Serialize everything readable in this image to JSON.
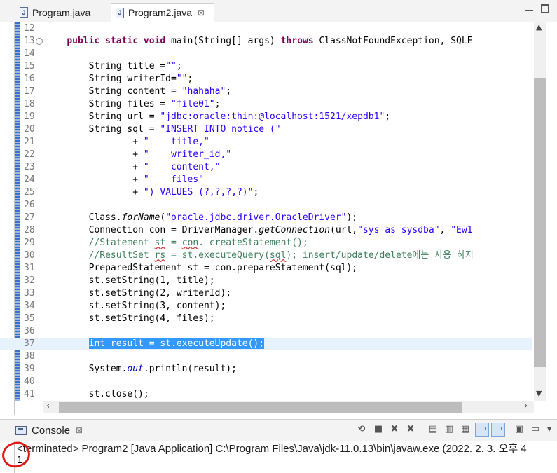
{
  "tabs": [
    {
      "label": "Program.java",
      "icon": "java-file-icon"
    },
    {
      "label": "Program2.java",
      "icon": "java-file-icon",
      "active": true,
      "close": "⊠"
    }
  ],
  "editor": {
    "lines": [
      {
        "n": "12",
        "segs": []
      },
      {
        "n": "13",
        "fold": "−",
        "segs": [
          {
            "t": "    "
          },
          {
            "t": "public",
            "c": "kw"
          },
          {
            "t": " "
          },
          {
            "t": "static",
            "c": "kw"
          },
          {
            "t": " "
          },
          {
            "t": "void",
            "c": "kw"
          },
          {
            "t": " main(String[] args) "
          },
          {
            "t": "throws",
            "c": "kw"
          },
          {
            "t": " ClassNotFoundException, SQLE"
          }
        ]
      },
      {
        "n": "14",
        "segs": []
      },
      {
        "n": "15",
        "segs": [
          {
            "t": "        String title ="
          },
          {
            "t": "\"\"",
            "c": "str"
          },
          {
            "t": ";"
          }
        ]
      },
      {
        "n": "16",
        "segs": [
          {
            "t": "        String writerId="
          },
          {
            "t": "\"\"",
            "c": "str"
          },
          {
            "t": ";"
          }
        ]
      },
      {
        "n": "17",
        "segs": [
          {
            "t": "        String content = "
          },
          {
            "t": "\"hahaha\"",
            "c": "str"
          },
          {
            "t": ";"
          }
        ]
      },
      {
        "n": "18",
        "segs": [
          {
            "t": "        String files = "
          },
          {
            "t": "\"file01\"",
            "c": "str"
          },
          {
            "t": ";"
          }
        ]
      },
      {
        "n": "19",
        "segs": [
          {
            "t": "        String url = "
          },
          {
            "t": "\"jdbc:oracle:thin:@localhost:1521/xepdb1\"",
            "c": "str"
          },
          {
            "t": ";"
          }
        ]
      },
      {
        "n": "20",
        "segs": [
          {
            "t": "        String sql = "
          },
          {
            "t": "\"INSERT INTO notice (\"",
            "c": "str"
          }
        ]
      },
      {
        "n": "21",
        "segs": [
          {
            "t": "                + "
          },
          {
            "t": "\"    title,\"",
            "c": "str"
          }
        ]
      },
      {
        "n": "22",
        "segs": [
          {
            "t": "                + "
          },
          {
            "t": "\"    writer_id,\"",
            "c": "str"
          }
        ]
      },
      {
        "n": "23",
        "segs": [
          {
            "t": "                + "
          },
          {
            "t": "\"    content,\"",
            "c": "str"
          }
        ]
      },
      {
        "n": "24",
        "segs": [
          {
            "t": "                + "
          },
          {
            "t": "\"    files\"",
            "c": "str"
          }
        ]
      },
      {
        "n": "25",
        "segs": [
          {
            "t": "                + "
          },
          {
            "t": "\") VALUES (?,?,?,?)\"",
            "c": "str"
          },
          {
            "t": ";"
          }
        ]
      },
      {
        "n": "26",
        "segs": []
      },
      {
        "n": "27",
        "segs": [
          {
            "t": "        Class."
          },
          {
            "t": "forName",
            "c": "ital"
          },
          {
            "t": "("
          },
          {
            "t": "\"oracle.jdbc.driver.OracleDriver\"",
            "c": "str"
          },
          {
            "t": ");"
          }
        ]
      },
      {
        "n": "28",
        "segs": [
          {
            "t": "        Connection con = DriverManager."
          },
          {
            "t": "getConnection",
            "c": "ital"
          },
          {
            "t": "(url,"
          },
          {
            "t": "\"sys as sysdba\"",
            "c": "str"
          },
          {
            "t": ", "
          },
          {
            "t": "\"Ew1",
            "c": "str"
          }
        ]
      },
      {
        "n": "29",
        "segs": [
          {
            "t": "        //Statement ",
            "c": "com"
          },
          {
            "t": "st",
            "c": "com squig"
          },
          {
            "t": " = ",
            "c": "com"
          },
          {
            "t": "con",
            "c": "com squig"
          },
          {
            "t": ". createStatement();",
            "c": "com"
          }
        ]
      },
      {
        "n": "30",
        "segs": [
          {
            "t": "        //ResultSet ",
            "c": "com"
          },
          {
            "t": "rs",
            "c": "com squig"
          },
          {
            "t": " = st.executeQuery(",
            "c": "com"
          },
          {
            "t": "sql",
            "c": "com squig"
          },
          {
            "t": "); insert/update/delete에는 사용 하지",
            "c": "com"
          }
        ]
      },
      {
        "n": "31",
        "segs": [
          {
            "t": "        PreparedStatement st = con.prepareStatement(sql);"
          }
        ]
      },
      {
        "n": "32",
        "segs": [
          {
            "t": "        st.setString(1, title);"
          }
        ]
      },
      {
        "n": "33",
        "segs": [
          {
            "t": "        st.setString(2, writerId);"
          }
        ]
      },
      {
        "n": "34",
        "segs": [
          {
            "t": "        st.setString(3, content);"
          }
        ]
      },
      {
        "n": "35",
        "segs": [
          {
            "t": "        st.setString(4, files);"
          }
        ]
      },
      {
        "n": "36",
        "segs": []
      },
      {
        "n": "37",
        "current": true,
        "segs": [
          {
            "t": "        "
          },
          {
            "t": "int result = st.executeUpdate();",
            "c": "sel"
          }
        ]
      },
      {
        "n": "38",
        "segs": []
      },
      {
        "n": "39",
        "segs": [
          {
            "t": "        System."
          },
          {
            "t": "out",
            "c": "field"
          },
          {
            "t": ".println(result);"
          }
        ]
      },
      {
        "n": "40",
        "segs": []
      },
      {
        "n": "41",
        "segs": [
          {
            "t": "        st.close();"
          }
        ]
      }
    ]
  },
  "console": {
    "tab_label": "Console",
    "tab_close": "⊠",
    "status": "<terminated> Program2 [Java Application] C:\\Program Files\\Java\\jdk-11.0.13\\bin\\javaw.exe  (2022. 2. 3. 오후 4",
    "output": "1",
    "toolbar_icons": [
      "pin-icon",
      "terminate-icon",
      "remove-launch-icon",
      "remove-all-icon",
      "scroll-lock-icon",
      "word-wrap-icon",
      "show-stdout-icon",
      "show-stderr-icon",
      "open-console-icon",
      "display-console-icon",
      "view-menu-icon"
    ]
  },
  "colors": {
    "keyword": "#7f0055",
    "string": "#2a00ff",
    "comment": "#3f7f5f",
    "selection": "#3399ff",
    "annotation_circle": "#e01818"
  }
}
